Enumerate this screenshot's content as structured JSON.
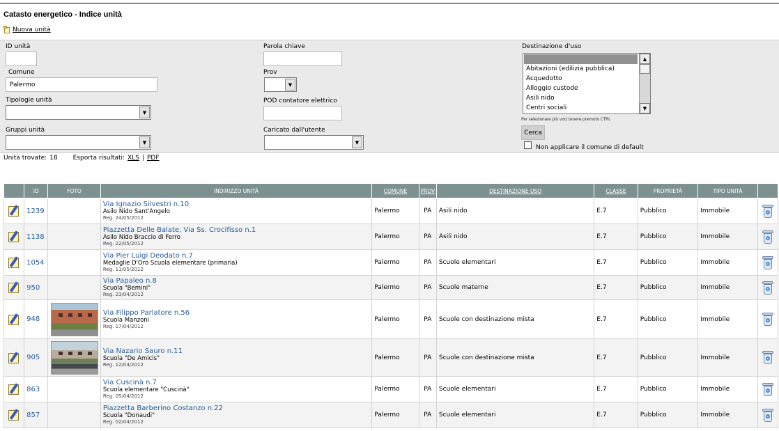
{
  "page": {
    "title": "Catasto energetico - Indice unità",
    "new_unit_label": "Nuova unità"
  },
  "filters": {
    "id_label": "ID unità",
    "id_value": "",
    "keyword_label": "Parola chiave",
    "keyword_value": "",
    "comune_label": "Comune",
    "comune_value": "Palermo",
    "prov_label": "Prov",
    "prov_value": "",
    "tipologie_label": "Tipologie unità",
    "tipologie_value": "",
    "pod_label": "POD contatore elettrico",
    "pod_value": "",
    "gruppi_label": "Gruppi unità",
    "gruppi_value": "",
    "caricato_label": "Caricato dall'utente",
    "caricato_value": "",
    "destinazione_label": "Destinazione d'uso",
    "destinazione_options": [
      "",
      "Abitazioni (edilizia pubblica)",
      "Acquedotto",
      "Alloggio custode",
      "Asili nido",
      "Centri sociali"
    ],
    "destinazione_hint": "Per selezionare più voci tenere premuto CTRL",
    "search_button": "Cerca",
    "no_default_label": "Non applicare il comune di default"
  },
  "summary": {
    "found_label": "Unità trovate:",
    "found_count": "18",
    "export_label": "Esporta risultati:",
    "xls": "XLS",
    "separator": "|",
    "pdf": "PDF"
  },
  "table": {
    "headers": {
      "id": "ID",
      "foto": "FOTO",
      "indirizzo": "INDIRIZZO UNITÀ",
      "comune": "COMUNE",
      "prov": "PROV",
      "destinazione": "DESTINAZIONE USO",
      "classe": "CLASSE",
      "proprieta": "PROPRIETÀ",
      "tipo": "TIPO UNITÀ"
    },
    "rows": [
      {
        "id": "1239",
        "street": "Via Ignazio Silvestri n.10",
        "desc": "Asilo Nido Sant'Angelo",
        "reg": "Reg. 24/05/2012",
        "comune": "Palermo",
        "prov": "PA",
        "destinazione": "Asili nido",
        "classe": "E.7",
        "proprieta": "Pubblico",
        "tipo": "Immobile"
      },
      {
        "id": "1138",
        "street": "Piazzetta Delle Balate, Via Ss. Crocifisso n.1",
        "desc": "Asilo Nido Braccio di Ferro",
        "reg": "Reg. 22/05/2012",
        "comune": "Palermo",
        "prov": "PA",
        "destinazione": "Asili nido",
        "classe": "E.7",
        "proprieta": "Pubblico",
        "tipo": "Immobile"
      },
      {
        "id": "1054",
        "street": "Via Pier Luigi Deodato n.7",
        "desc": "Medaglie D'Oro Scuola elementare (primaria)",
        "reg": "Reg. 11/05/2012",
        "comune": "Palermo",
        "prov": "PA",
        "destinazione": "Scuole elementari",
        "classe": "E.7",
        "proprieta": "Pubblico",
        "tipo": "Immobile"
      },
      {
        "id": "950",
        "street": "Via Papaleo n.8",
        "desc": "Scuola \"Bemini\"",
        "reg": "Reg. 23/04/2012",
        "comune": "Palermo",
        "prov": "PA",
        "destinazione": "Scuole materne",
        "classe": "E.7",
        "proprieta": "Pubblico",
        "tipo": "Immobile"
      },
      {
        "id": "948",
        "street": "Via Filippo Parlatore n.56",
        "desc": "Scuola Manzoni",
        "reg": "Reg. 17/04/2012",
        "comune": "Palermo",
        "prov": "PA",
        "destinazione": "Scuole con destinazione mista",
        "classe": "E.7",
        "proprieta": "Pubblico",
        "tipo": "Immobile"
      },
      {
        "id": "905",
        "street": "Via Nazario Sauro n.11",
        "desc": "Scuola \"De Amicis\"",
        "reg": "Reg. 12/04/2012",
        "comune": "Palermo",
        "prov": "PA",
        "destinazione": "Scuole con destinazione mista",
        "classe": "E.7",
        "proprieta": "Pubblico",
        "tipo": "Immobile"
      },
      {
        "id": "863",
        "street": "Via Cuscinà n.7",
        "desc": "Scuola elementare \"Cuscinà\"",
        "reg": "Reg. 05/04/2012",
        "comune": "Palermo",
        "prov": "PA",
        "destinazione": "Scuole elementari",
        "classe": "E.7",
        "proprieta": "Pubblico",
        "tipo": "Immobile"
      },
      {
        "id": "857",
        "street": "Piazzetta Barberino Costanzo n.22",
        "desc": "Scuola \"Donaudi\"",
        "reg": "Reg. 02/04/2012",
        "comune": "Palermo",
        "prov": "PA",
        "destinazione": "Scuole elementari",
        "classe": "E.7",
        "proprieta": "Pubblico",
        "tipo": "Immobile"
      }
    ]
  },
  "icons": {
    "new": "note-icon",
    "edit": "edit-icon",
    "delete": "trash-icon"
  },
  "colors": {
    "header_bg": "#7e9191",
    "link": "#2a5c9a",
    "filter_bg": "#eaeaea"
  }
}
